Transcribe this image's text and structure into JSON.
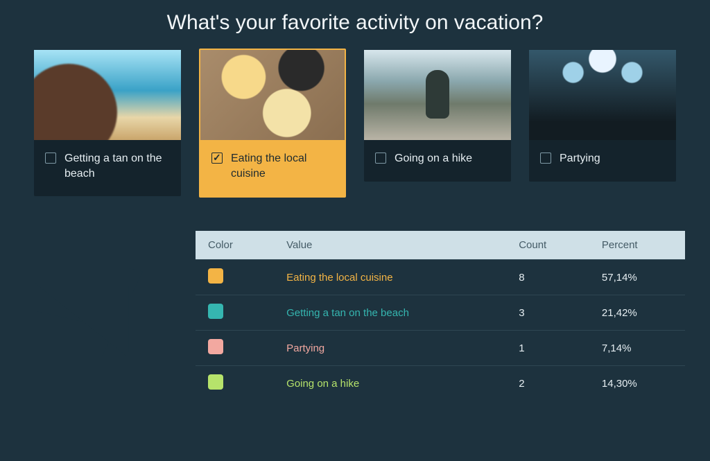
{
  "title": "What's your favorite activity on vacation?",
  "options": [
    {
      "label": "Getting a tan on the beach",
      "selected": false,
      "thumb": "beach"
    },
    {
      "label": "Eating the local cuisine",
      "selected": true,
      "thumb": "food"
    },
    {
      "label": "Going on a hike",
      "selected": false,
      "thumb": "hike"
    },
    {
      "label": "Partying",
      "selected": false,
      "thumb": "party"
    }
  ],
  "table": {
    "headers": {
      "color": "Color",
      "value": "Value",
      "count": "Count",
      "percent": "Percent"
    },
    "rows": [
      {
        "color": "#f3b445",
        "value": "Eating the local cuisine",
        "count": "8",
        "percent": "57,14%"
      },
      {
        "color": "#35b6b0",
        "value": "Getting a tan on the beach",
        "count": "3",
        "percent": "21,42%"
      },
      {
        "color": "#f2a8a0",
        "value": "Partying",
        "count": "1",
        "percent": "7,14%"
      },
      {
        "color": "#b6e36b",
        "value": "Going on a hike",
        "count": "2",
        "percent": "14,30%"
      }
    ]
  },
  "chart_data": {
    "type": "pie",
    "title": "What's your favorite activity on vacation?",
    "categories": [
      "Eating the local cuisine",
      "Getting a tan on the beach",
      "Partying",
      "Going on a hike"
    ],
    "values": [
      8,
      3,
      1,
      2
    ],
    "percent_labels": [
      "57,14%",
      "21,42%",
      "7,14%",
      "14,30%"
    ],
    "colors": [
      "#f3b445",
      "#35b6b0",
      "#f2a8a0",
      "#b6e36b"
    ],
    "legend_position": "right-table"
  }
}
